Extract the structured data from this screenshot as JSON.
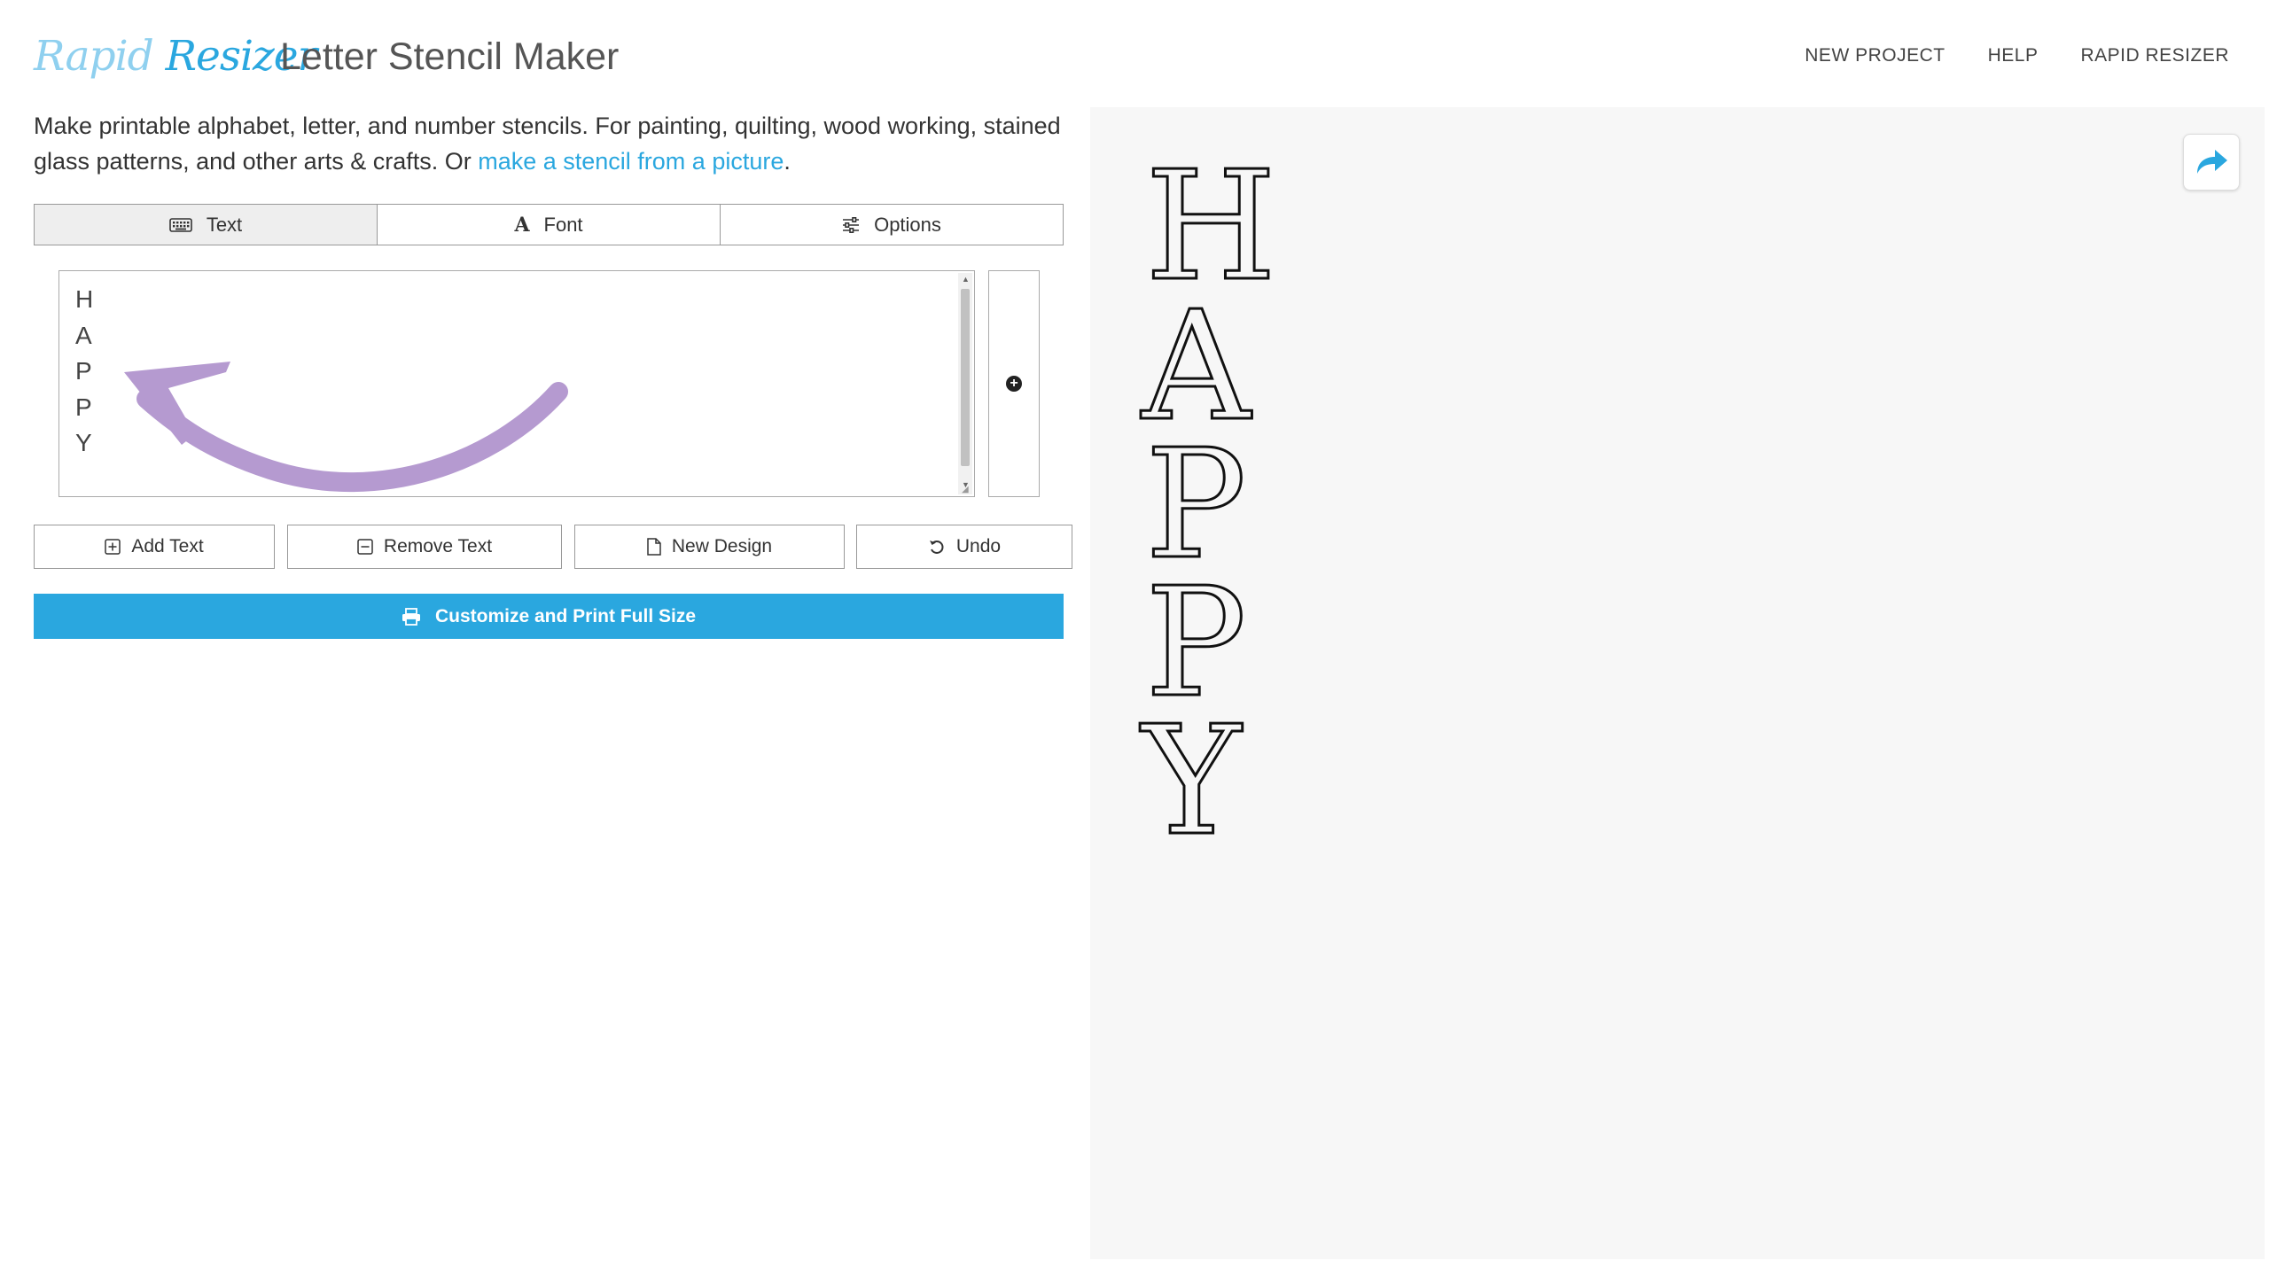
{
  "header": {
    "logo_part1": "Rapid",
    "logo_part2": "Resizer",
    "title": "Letter Stencil Maker",
    "nav": [
      "NEW PROJECT",
      "HELP",
      "RAPID RESIZER"
    ]
  },
  "intro": {
    "text": "Make printable alphabet, letter, and number stencils. For painting, quilting, wood working, stained glass patterns, and other arts & crafts. Or ",
    "link": "make a stencil from a picture",
    "suffix": "."
  },
  "tabs": [
    {
      "label": "Text",
      "icon": "keyboard-icon",
      "active": true
    },
    {
      "label": "Font",
      "icon": "font-icon",
      "active": false
    },
    {
      "label": "Options",
      "icon": "sliders-icon",
      "active": false
    }
  ],
  "editor": {
    "lines": [
      "H",
      "A",
      "P",
      "P",
      "Y"
    ],
    "annotation_color": "#b59ad0"
  },
  "actions": {
    "add_text": "Add Text",
    "remove_text": "Remove Text",
    "new_design": "New Design",
    "undo": "Undo"
  },
  "print_button": "Customize and Print Full Size",
  "preview": {
    "letters": [
      "H",
      "A",
      "P",
      "P",
      "Y"
    ]
  },
  "colors": {
    "accent": "#2aa7df",
    "preview_bg": "#f7f7f7"
  }
}
